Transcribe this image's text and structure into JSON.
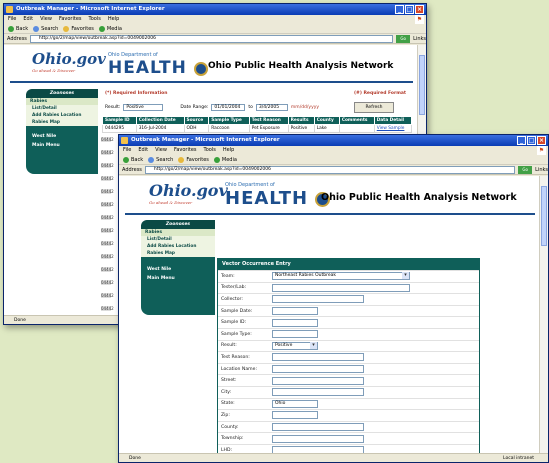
{
  "back_window": {
    "title": "Outbreak Manager - Microsoft Internet Explorer",
    "menu": [
      "File",
      "Edit",
      "View",
      "Favorites",
      "Tools",
      "Help"
    ],
    "toolbar": {
      "back": "Back",
      "search": "Search",
      "favorites": "Favorites",
      "media": "Media"
    },
    "address_label": "Address",
    "address": "http://go/2/map/view/outbreak.asp?id=0049002006",
    "go": "Go",
    "links": "Links",
    "network_title": "Ohio Public Health Analysis Network",
    "sidebar": {
      "header": "Zoonoses",
      "sub": "Rabies",
      "links": [
        "List/Detail",
        "Add Rabies Location",
        "Rabies Map"
      ],
      "main_links": [
        "West Nile",
        "Main Menu"
      ]
    },
    "form": {
      "required_info": "(*) Required Information",
      "required_format": "(#) Required Format",
      "result_label": "Result:",
      "result_value": "Positive",
      "date_range_label": "Date Range:",
      "date_from": "01/01/2004",
      "to_label": "to",
      "date_to": "3/4/2005",
      "date_hint": "mm/dd/yyyy",
      "refresh": "Refresh"
    },
    "table": {
      "headers": [
        "Sample ID",
        "Collection Date",
        "Source",
        "Sample Type",
        "Test Reason",
        "Results",
        "County",
        "Comments",
        "Data Detail"
      ],
      "rows": [
        [
          "0444295",
          "316-Jul-2004",
          "ODH",
          "Raccoon",
          "Pet Exposure",
          "Positive",
          "Lake",
          "",
          "View Sample"
        ]
      ],
      "row_tags": [
        "04442",
        "04442",
        "04442",
        "04442",
        "04442",
        "04442",
        "04442",
        "04442",
        "04442",
        "04442",
        "04442",
        "04442",
        "04442",
        "04442",
        "04442"
      ]
    },
    "status": "Done"
  },
  "front_window": {
    "title": "Outbreak Manager - Microsoft Internet Explorer",
    "menu": [
      "File",
      "Edit",
      "View",
      "Favorites",
      "Tools",
      "Help"
    ],
    "toolbar": {
      "back": "Back",
      "search": "Search",
      "favorites": "Favorites",
      "media": "Media"
    },
    "address_label": "Address",
    "address": "http://go/2/map/view/outbreak.asp?id=0049002006",
    "go": "Go",
    "links": "Links",
    "logo_text": "Ohio.gov",
    "logo_sub": "Go ahead & Discover",
    "dept_text": "Ohio Department of",
    "health_text": "HEALTH",
    "network_title": "Ohio Public Health Analysis Network",
    "sidebar": {
      "header": "Zoonoses",
      "sub": "Rabies",
      "links": [
        "List/Detail",
        "Add Rabies Location",
        "Rabies Map"
      ],
      "main_links": [
        "West Nile",
        "Main Menu"
      ]
    },
    "vector_form": {
      "title": "Vector Occurrence Entry",
      "fields": [
        {
          "label": "Team:",
          "value": "Northeast Rabies Outbreak",
          "kind": "select",
          "w": "long"
        },
        {
          "label": "Tester/Lab:",
          "value": "",
          "kind": "text",
          "w": "long"
        },
        {
          "label": "Collector:",
          "value": "",
          "kind": "text",
          "w": "mid"
        },
        {
          "label": "Sample Date:",
          "value": "",
          "kind": "text",
          "w": "short"
        },
        {
          "label": "Sample ID:",
          "value": "",
          "kind": "text",
          "w": "short"
        },
        {
          "label": "Sample Type:",
          "value": "",
          "kind": "text",
          "w": "short"
        },
        {
          "label": "Result:",
          "value": "Positive",
          "kind": "select",
          "w": "sel"
        },
        {
          "label": "Test Reason:",
          "value": "",
          "kind": "text",
          "w": "mid"
        },
        {
          "label": "Location Name:",
          "value": "",
          "kind": "text",
          "w": "mid"
        },
        {
          "label": "Street:",
          "value": "",
          "kind": "text",
          "w": "mid"
        },
        {
          "label": "City:",
          "value": "",
          "kind": "text",
          "w": "mid"
        },
        {
          "label": "State:",
          "value": "Ohio",
          "kind": "text",
          "w": "short"
        },
        {
          "label": "Zip:",
          "value": "",
          "kind": "text",
          "w": "short"
        },
        {
          "label": "County:",
          "value": "",
          "kind": "text",
          "w": "mid"
        },
        {
          "label": "Township:",
          "value": "",
          "kind": "text",
          "w": "mid"
        },
        {
          "label": "LHD:",
          "value": "",
          "kind": "text",
          "w": "mid"
        }
      ]
    },
    "status": "Done",
    "zone": "Local intranet"
  },
  "colors": {
    "teal": "#0f5f59",
    "navy": "#1d4e8c",
    "xp_blue": "#0a3cb4",
    "backdrop": "#dfe9c3"
  },
  "icons": [
    "ie-page-icon",
    "minimize-icon",
    "maximize-icon",
    "close-icon",
    "back-arrow-icon",
    "search-icon",
    "favorites-star-icon",
    "ohio-seal-icon",
    "windows-flag-icon"
  ]
}
